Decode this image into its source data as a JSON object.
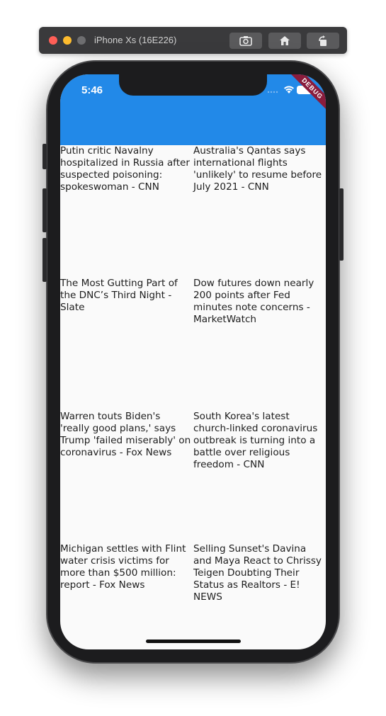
{
  "simulator": {
    "device_title": "iPhone Xs (16E226)",
    "buttons": [
      {
        "icon": "camera-icon"
      },
      {
        "icon": "home-icon"
      },
      {
        "icon": "rotate-icon"
      }
    ]
  },
  "status_bar": {
    "time": "5:46",
    "debug_banner": "DEBUG"
  },
  "colors": {
    "appbar": "#2289e8",
    "background": "#fafafa",
    "debug_ribbon": "#8a1c3c"
  },
  "news": [
    {
      "title": "Putin critic Navalny hospitalized in Russia after suspected poisoning: spokeswoman - CNN"
    },
    {
      "title": "Australia's Qantas says international flights 'unlikely' to resume before July 2021 - CNN"
    },
    {
      "title": "The Most Gutting Part of the DNC’s Third Night - Slate"
    },
    {
      "title": "Dow futures down nearly 200 points after Fed minutes note concerns - MarketWatch"
    },
    {
      "title": "Warren touts Biden's 'really good plans,' says Trump 'failed miserably' on coronavirus - Fox News"
    },
    {
      "title": "South Korea's latest church-linked coronavirus outbreak is turning into a battle over religious freedom - CNN"
    },
    {
      "title": "Michigan settles with Flint water crisis victims for more than $500 million: report - Fox News"
    },
    {
      "title": "Selling Sunset's Davina and Maya React to Chrissy Teigen Doubting Their Status as Realtors - E! NEWS"
    }
  ]
}
